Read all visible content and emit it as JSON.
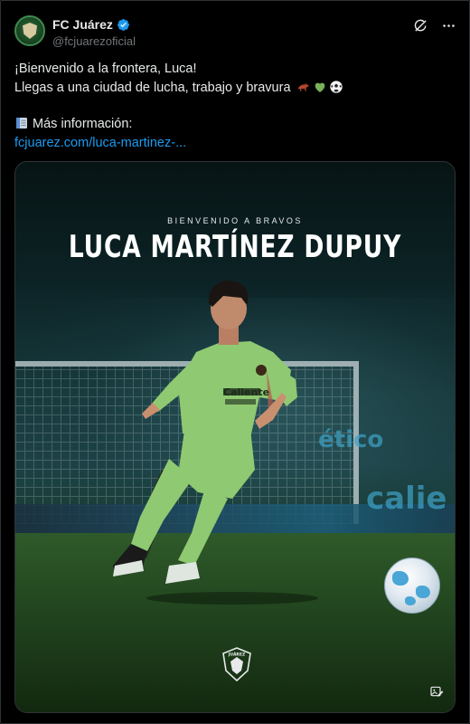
{
  "tweet": {
    "display_name": "FC Juárez",
    "handle": "@fcjuarezoficial",
    "lines": [
      "¡Bienvenido a la frontera, Luca!",
      "Llegas a una ciudad de lucha, trabajo y bravura"
    ],
    "line2_emojis": [
      "horse-emoji",
      "green-heart-emoji",
      "soccer-ball-emoji"
    ],
    "info_label": "Más información:",
    "link_text": "fcjuarez.com/luca-martinez-..."
  },
  "header_icons": [
    "grok-icon",
    "more-icon"
  ],
  "media": {
    "kicker": "BIENVENIDO A BRAVOS",
    "player_name": "LUCA MARTÍNEZ DUPUY",
    "jersey_sponsor": "Caliente",
    "board_text_left": "ético",
    "board_text_right": "calie",
    "logo_text": "JUÁREZ"
  },
  "colors": {
    "background": "#000000",
    "link": "#1d9bf0",
    "verified": "#1d9bf0",
    "secondary_text": "#71767b",
    "jersey": "#8fc972"
  }
}
